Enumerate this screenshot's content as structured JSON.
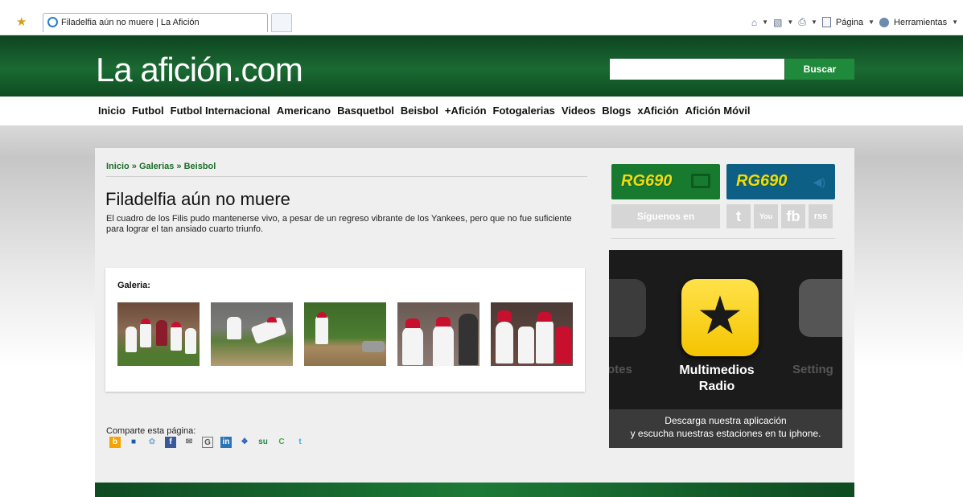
{
  "browser": {
    "tab_title": "Filadelfia aún no muere | La Afición",
    "command_bar": {
      "page_label": "Página",
      "tools_label": "Herramientas"
    }
  },
  "site": {
    "logo": "La afición.com",
    "search": {
      "value": "",
      "button": "Buscar"
    },
    "nav": [
      "Inicio",
      "Futbol",
      "Futbol Internacional",
      "Americano",
      "Basquetbol",
      "Beisbol",
      "+Afición",
      "Fotogalerias",
      "Videos",
      "Blogs",
      "xAfición",
      "Afición Móvil"
    ]
  },
  "article": {
    "breadcrumb": "Inicio » Galerias » Beisbol",
    "title": "Filadelfia aún no muere",
    "description": "El cuadro de los Filis pudo mantenerse vivo, a pesar de un regreso vibrante de los Yankees, pero que no fue suficiente para lograr el tan ansiado cuarto triunfo.",
    "gallery_label": "Galeria:",
    "thumbnails": 5,
    "share_label": "Comparte esta página:"
  },
  "sidebar": {
    "rg1": "RG690",
    "rg2": "RG690",
    "follow_label": "Síguenos en",
    "social": [
      "t",
      "You",
      "fb",
      "rss"
    ],
    "radio_ad": {
      "left_app_label": "otes",
      "right_app_label": "Setting",
      "app_name_line1": "Multimedios",
      "app_name_line2": "Radio",
      "band_line1": "Descarga nuestra aplicación",
      "band_line2": "y escucha nuestras estaciones  en tu iphone."
    }
  },
  "colors": {
    "brand_green": "#1b6a33",
    "accent_green": "#1f8a3b",
    "rg_yellow": "#f5d90f"
  }
}
